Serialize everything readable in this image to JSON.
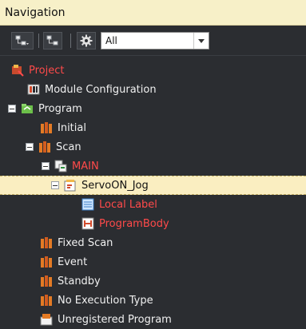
{
  "window": {
    "title": "Navigation"
  },
  "toolbar": {
    "filter_value": "All",
    "icons": [
      "tree-expand-icon",
      "tree-collapse-icon",
      "settings-icon",
      "dropdown-arrow-icon"
    ]
  },
  "tree": {
    "project": "Project",
    "module_configuration": "Module Configuration",
    "program": "Program",
    "initial": "Initial",
    "scan": "Scan",
    "main": "MAIN",
    "servoon_jog": "ServoON_Jog",
    "local_label": "Local Label",
    "program_body": "ProgramBody",
    "fixed_scan": "Fixed Scan",
    "event": "Event",
    "standby": "Standby",
    "no_execution_type": "No Execution Type",
    "unregistered_program": "Unregistered Program"
  },
  "colors": {
    "background": "#2b2d31",
    "title_bar": "#f7f0c8",
    "selected_row": "#faeec1",
    "error_text": "#ff4a4a"
  }
}
